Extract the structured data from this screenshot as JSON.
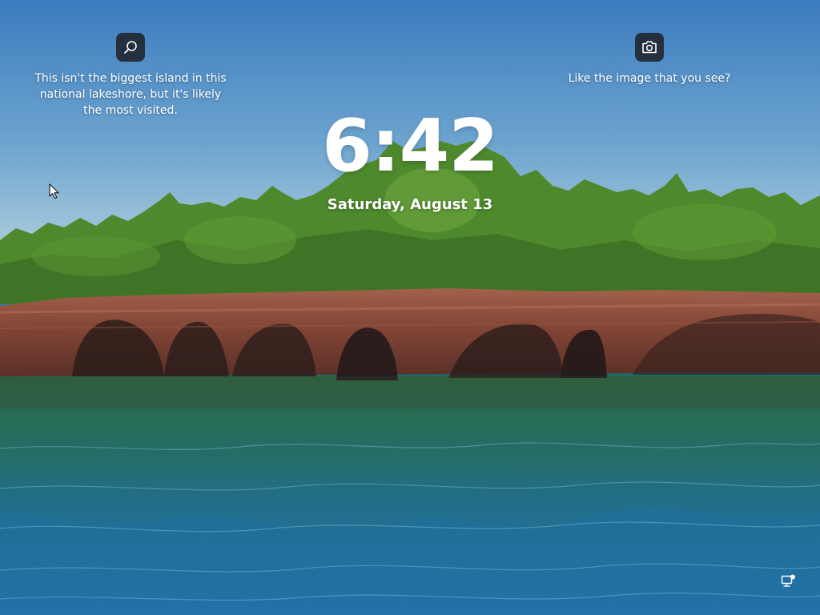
{
  "lock_screen": {
    "time": "6:42",
    "date": "Saturday, August 13"
  },
  "spotlight": {
    "left": {
      "icon": "search-icon",
      "caption": "This isn't the biggest island in this national lakeshore, but it's likely the most visited."
    },
    "right": {
      "icon": "camera-icon",
      "caption": "Like the image that you see?"
    }
  },
  "system_tray": {
    "icon": "network-icon"
  },
  "colors": {
    "sky_top": "#3d7fc0",
    "sky_bottom": "#a9c9dc",
    "foliage": "#4f8a2c",
    "rock": "#8a4b3c",
    "water": "#1f6a8a",
    "button_bg": "#1c1c20",
    "text": "#ffffff"
  }
}
